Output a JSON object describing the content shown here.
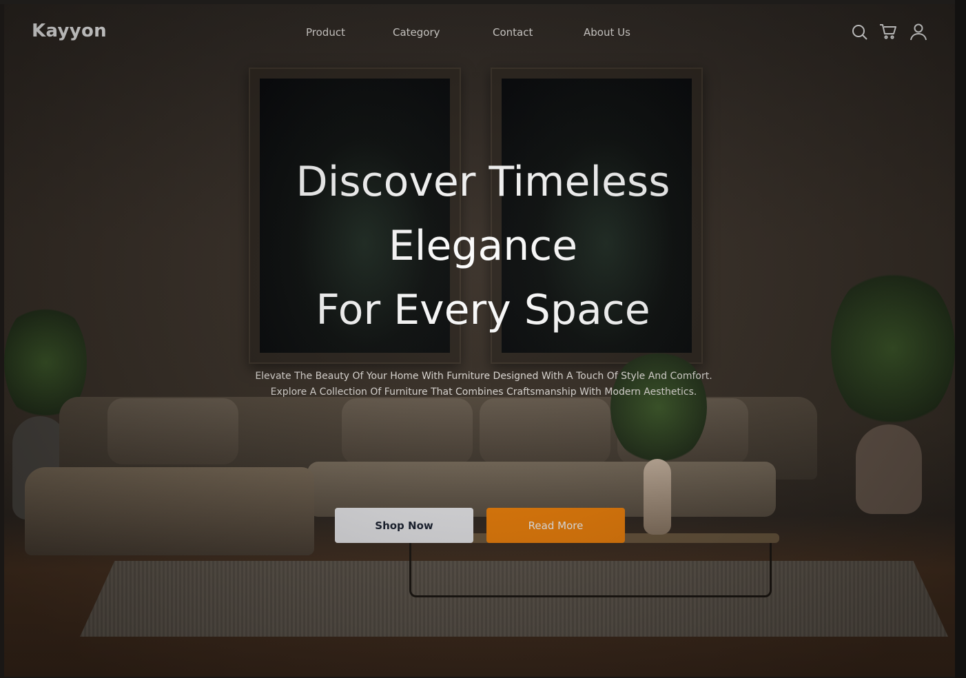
{
  "brand": {
    "name": "Kayyon"
  },
  "nav": {
    "items": [
      {
        "label": "Product"
      },
      {
        "label": "Category"
      },
      {
        "label": "Contact"
      },
      {
        "label": "About Us"
      }
    ],
    "icons": [
      "search-icon",
      "cart-icon",
      "user-icon"
    ]
  },
  "hero": {
    "title_lines": [
      "Discover Timeless",
      "Elegance",
      "For Every Space"
    ],
    "subtitle_lines": [
      "Elevate The Beauty Of Your Home With Furniture Designed With A Touch Of Style And Comfort.",
      "Explore A Collection Of Furniture That Combines Craftsmanship With Modern Aesthetics."
    ],
    "primary_button": "Shop Now",
    "secondary_button": "Read More"
  },
  "colors": {
    "accent": "#f7850a",
    "primary_button_bg": "#f1f1f4",
    "primary_button_text": "#1b2333",
    "text": "#ffffff"
  }
}
